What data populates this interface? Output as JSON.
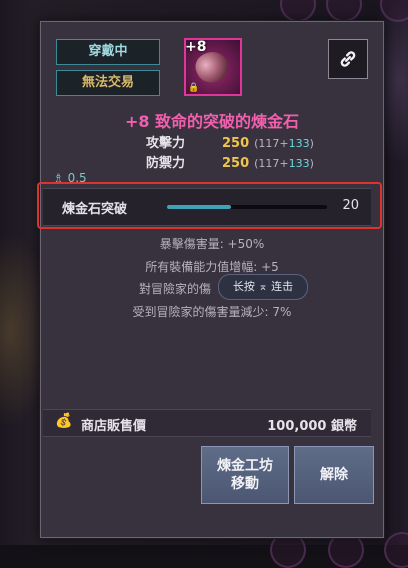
{
  "tags": {
    "equipped": "穿戴中",
    "no_trade": "無法交易"
  },
  "item": {
    "enhance_level": "+8",
    "name": "+8 致命的突破的煉金石",
    "rarity_color": "#e0359a"
  },
  "stats": [
    {
      "label": "攻擊力",
      "value": "250",
      "sub_open": "(117+",
      "sub_bonus": "133",
      "sub_close": ")"
    },
    {
      "label": "防禦力",
      "value": "250",
      "sub_open": "(117+",
      "sub_bonus": "133",
      "sub_close": ")"
    }
  ],
  "weight": "0.5",
  "refine": {
    "label": "煉金石突破",
    "value": "20",
    "progress": 0.4
  },
  "effects": [
    "暴擊傷害量: +50%",
    "所有裝備能力值增幅: +5",
    "對冒險家的傷",
    "受到冒險家的傷害量減少: 7%"
  ],
  "tooltip": "长按 ⌅ 连击",
  "sell": {
    "label": "商店販售價",
    "price": "100,000 銀幣"
  },
  "buttons": {
    "workshop_line1": "煉金工坊",
    "workshop_line2": "移動",
    "dismantle": "解除"
  },
  "icons": {
    "link": "link-icon",
    "bag": "money-bag-icon",
    "weight": "weight-icon",
    "lock": "lock-icon"
  },
  "colors": {
    "accent": "#f25fae",
    "stat_value": "#f0c54e",
    "bonus": "#6fd6e0",
    "highlight": "#e0322c",
    "progress": "#3fa3b8"
  }
}
